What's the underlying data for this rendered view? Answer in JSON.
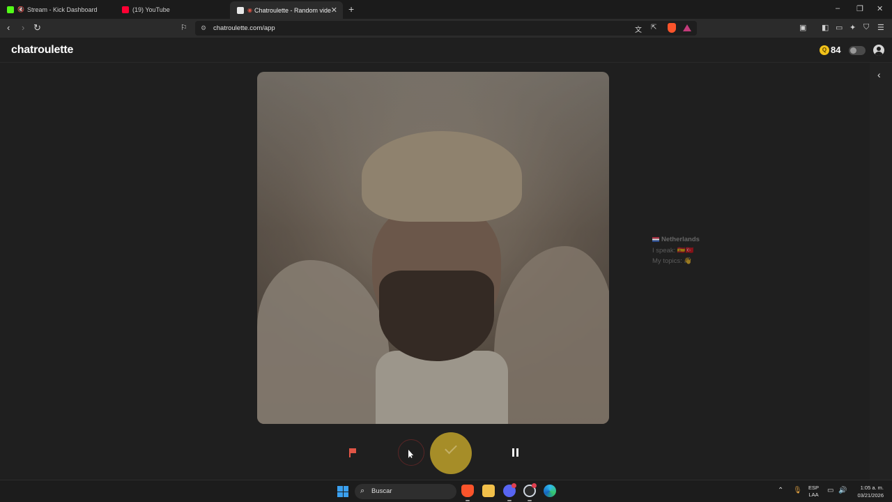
{
  "browser": {
    "tabs": [
      {
        "title": "Stream - Kick Dashboard",
        "favicon_color": "#53fc18"
      },
      {
        "title": "(19) YouTube",
        "favicon_color": "#ff0033"
      },
      {
        "title": "Chatroulette - Random video",
        "favicon_color": "#e8e8e8",
        "active": true
      }
    ],
    "new_tab_glyph": "+",
    "window_controls": {
      "minimize": "–",
      "restore": "❐",
      "close": "✕"
    },
    "url": "chatroulette.com/app",
    "icons": [
      "back-icon",
      "forward-icon",
      "reload-icon",
      "bookmark-icon",
      "site-info-icon",
      "translate-icon",
      "share-icon",
      "brave-shields-icon",
      "brave-rewards-icon",
      "sidebar-icon",
      "wallet-icon",
      "leo-ai-icon",
      "vpn-icon",
      "menu-icon"
    ]
  },
  "site": {
    "logo": "chatroulette",
    "coins": "84",
    "coin_symbol": "Q",
    "accent_color": "#a68d28",
    "report_color": "#e05546"
  },
  "partner": {
    "country": "Netherlands",
    "speaks_label": "I speak:",
    "speaks_flags": "🇪🇸🇹🇷",
    "topics_label": "My topics:",
    "topics_emoji": "👋"
  },
  "controls": {
    "report": "report-flag-icon",
    "stop": "stop-button",
    "next": "check-icon",
    "pause": "pause-icon"
  },
  "taskbar": {
    "search_placeholder": "Buscar",
    "discord_badge": "9+",
    "lang_top": "ESP",
    "lang_bottom": "LAA",
    "time": "1:05 a. m.",
    "date": "03/21/2026"
  }
}
